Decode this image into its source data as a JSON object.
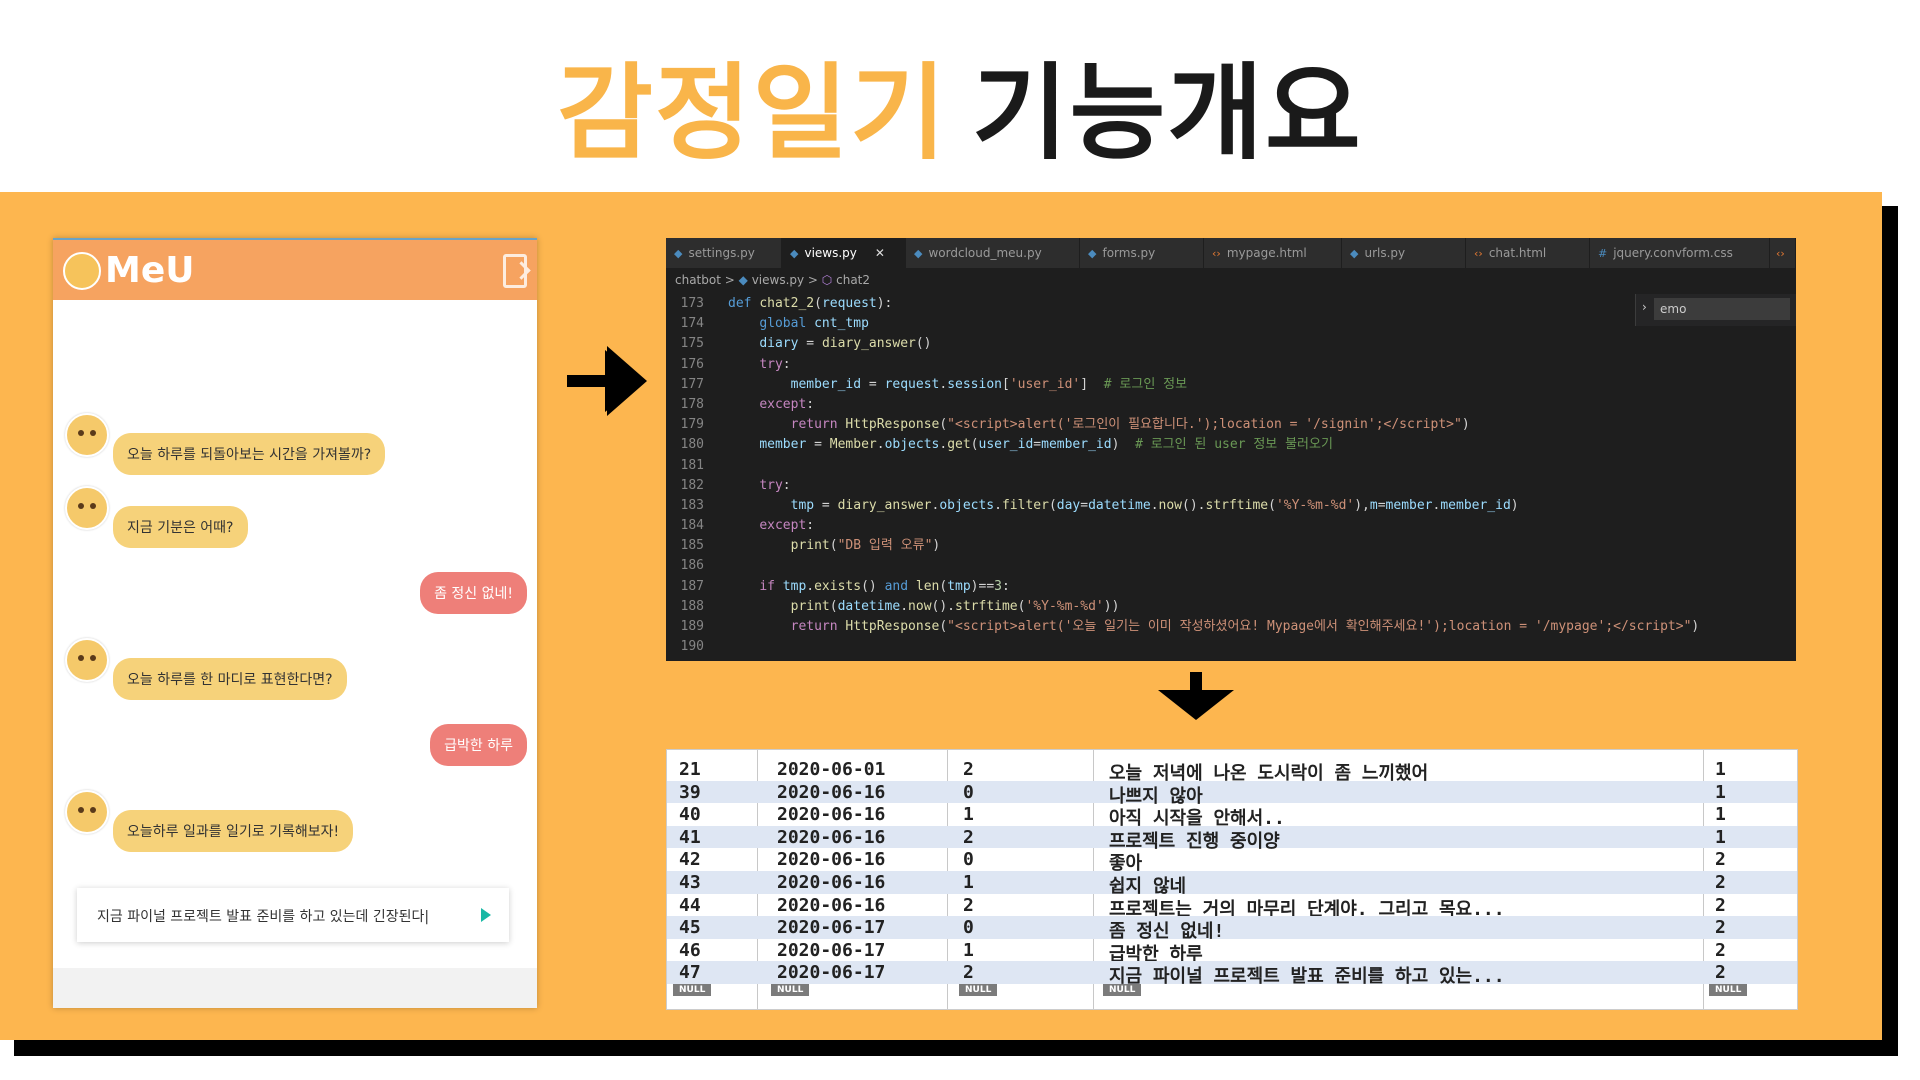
{
  "title": {
    "accent": "감정일기",
    "rest": "기능개요"
  },
  "chat": {
    "logo": "MeU",
    "messages": [
      {
        "from": "bot",
        "text": "오늘 하루를 되돌아보는 시간을 가져볼까?"
      },
      {
        "from": "bot",
        "text": "지금 기분은 어때?"
      },
      {
        "from": "user",
        "text": "좀 정신 없네!"
      },
      {
        "from": "bot",
        "text": "오늘 하루를 한 마디로 표현한다면?"
      },
      {
        "from": "user",
        "text": "급박한 하루"
      },
      {
        "from": "bot",
        "text": "오늘하루 일과를 일기로 기록해보자!"
      }
    ],
    "input_value": "지금 파이널 프로젝트 발표 준비를 하고 있는데 긴장된다|"
  },
  "editor": {
    "tabs": [
      {
        "icon": "python-icon",
        "label": "settings.py",
        "active": false
      },
      {
        "icon": "python-icon",
        "label": "views.py",
        "active": true
      },
      {
        "icon": "python-icon",
        "label": "wordcloud_meu.py",
        "active": false
      },
      {
        "icon": "python-icon",
        "label": "forms.py",
        "active": false
      },
      {
        "icon": "html-icon",
        "label": "mypage.html",
        "active": false
      },
      {
        "icon": "python-icon",
        "label": "urls.py",
        "active": false
      },
      {
        "icon": "html-icon",
        "label": "chat.html",
        "active": false
      },
      {
        "icon": "css-icon",
        "label": "jquery.convform.css",
        "active": false
      }
    ],
    "breadcrumb": [
      "chatbot",
      "views.py",
      "chat2"
    ],
    "find_value": "emo",
    "line_numbers": [
      "173",
      "174",
      "175",
      "176",
      "177",
      "178",
      "179",
      "180",
      "181",
      "182",
      "183",
      "184",
      "185",
      "186",
      "187",
      "188",
      "189",
      "190"
    ]
  },
  "db": {
    "rows": [
      [
        "21",
        "2020-06-01",
        "2",
        "오늘 저녁에 나온 도시락이 좀 느끼했어",
        "1"
      ],
      [
        "39",
        "2020-06-16",
        "0",
        "나쁘지 않아",
        "1"
      ],
      [
        "40",
        "2020-06-16",
        "1",
        "아직 시작을 안해서..",
        "1"
      ],
      [
        "41",
        "2020-06-16",
        "2",
        "프로젝트 진행 중이양",
        "1"
      ],
      [
        "42",
        "2020-06-16",
        "0",
        "좋아",
        "2"
      ],
      [
        "43",
        "2020-06-16",
        "1",
        "쉽지 않네",
        "2"
      ],
      [
        "44",
        "2020-06-16",
        "2",
        "프로젝트는 거의 마무리 단계야. 그리고 목요...",
        "2"
      ],
      [
        "45",
        "2020-06-17",
        "0",
        "좀 정신 없네!",
        "2"
      ],
      [
        "46",
        "2020-06-17",
        "1",
        "급박한 하루",
        "2"
      ],
      [
        "47",
        "2020-06-17",
        "2",
        "지금 파이널 프로젝트 발표 준비를 하고 있는...",
        "2"
      ]
    ],
    "null_label": "NULL"
  }
}
